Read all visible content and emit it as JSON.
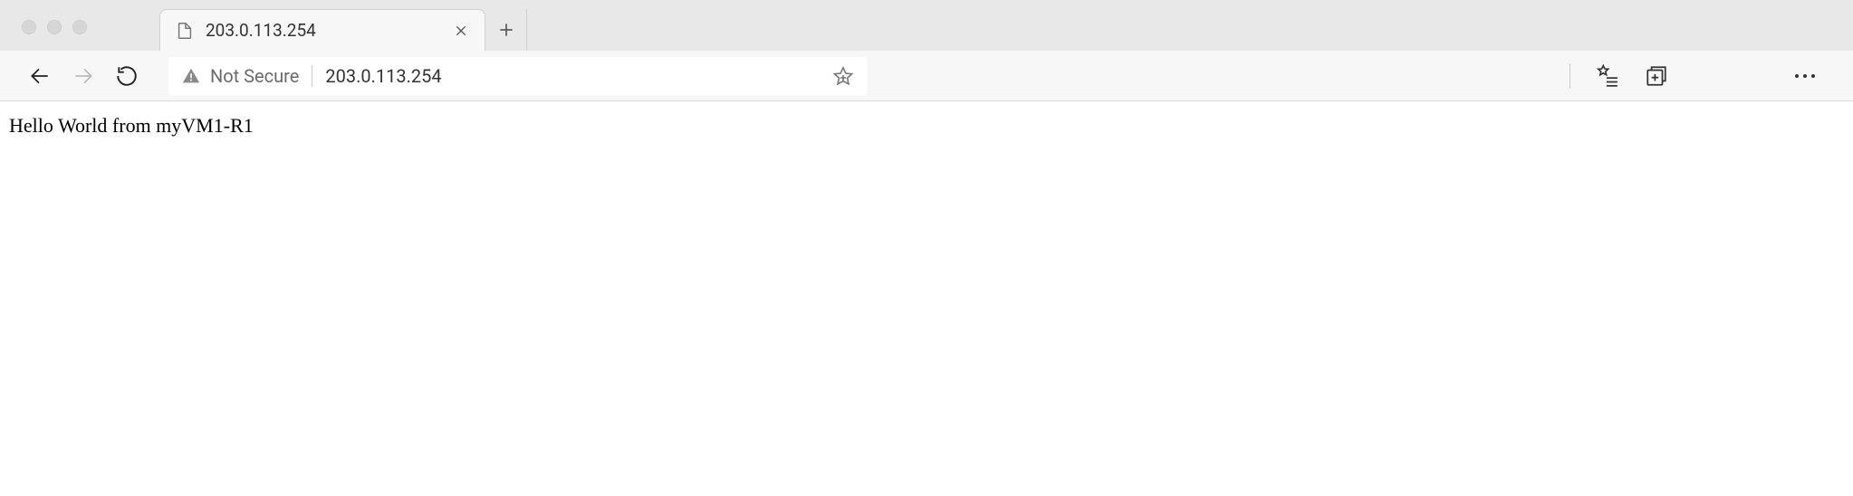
{
  "tab": {
    "title": "203.0.113.254"
  },
  "addressBar": {
    "securityLabel": "Not Secure",
    "url": "203.0.113.254"
  },
  "page": {
    "bodyText": "Hello World from myVM1-R1"
  }
}
